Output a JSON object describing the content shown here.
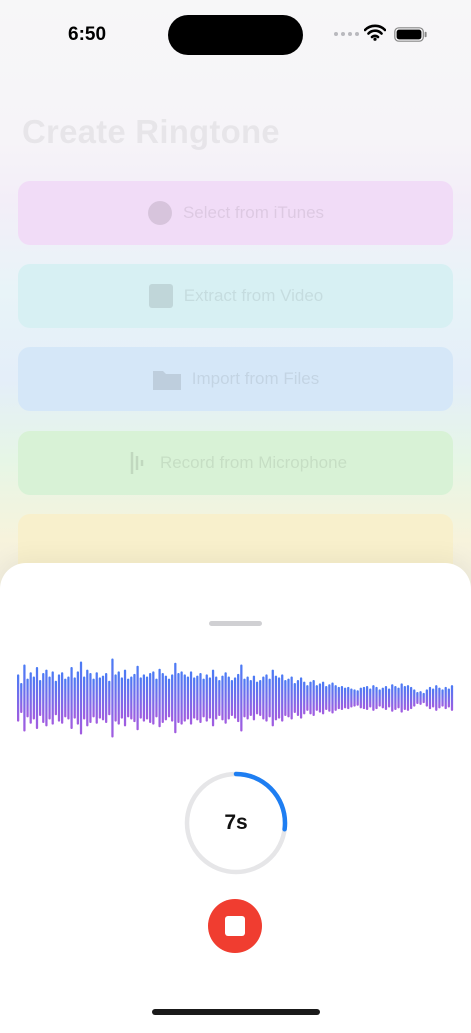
{
  "status_bar": {
    "time": "6:50"
  },
  "background_screen": {
    "title": "Create Ringtone",
    "options": [
      {
        "label": "Select from iTunes",
        "icon": "music-note-icon",
        "color": "#f1dcf7"
      },
      {
        "label": "Extract from Video",
        "icon": "video-icon",
        "color": "#d7f0f3"
      },
      {
        "label": "Import from Files",
        "icon": "folder-icon",
        "color": "#d5e7f8"
      },
      {
        "label": "Record from Microphone",
        "icon": "microphone-icon",
        "color": "#d8f2d6"
      },
      {
        "label": "",
        "icon": "",
        "color": "#f8f0cc"
      }
    ]
  },
  "recording_sheet": {
    "elapsed": "7s",
    "progress_fraction": 0.27,
    "colors": {
      "waveform_top": "#4a7bf5",
      "waveform_bottom": "#a25ce0",
      "progress": "#1e7ef2",
      "track": "#e6e6e8",
      "stop": "#f03d30"
    },
    "waveform_levels": [
      0.55,
      0.35,
      0.78,
      0.45,
      0.6,
      0.5,
      0.72,
      0.42,
      0.58,
      0.66,
      0.5,
      0.62,
      0.4,
      0.55,
      0.6,
      0.45,
      0.5,
      0.72,
      0.48,
      0.62,
      0.85,
      0.5,
      0.66,
      0.58,
      0.45,
      0.6,
      0.48,
      0.52,
      0.58,
      0.4,
      0.92,
      0.55,
      0.62,
      0.48,
      0.66,
      0.45,
      0.5,
      0.56,
      0.75,
      0.48,
      0.55,
      0.5,
      0.58,
      0.62,
      0.45,
      0.68,
      0.58,
      0.52,
      0.45,
      0.55,
      0.82,
      0.58,
      0.62,
      0.55,
      0.5,
      0.62,
      0.48,
      0.52,
      0.58,
      0.45,
      0.55,
      0.48,
      0.66,
      0.5,
      0.42,
      0.52,
      0.6,
      0.5,
      0.42,
      0.48,
      0.56,
      0.78,
      0.45,
      0.5,
      0.42,
      0.52,
      0.38,
      0.42,
      0.5,
      0.55,
      0.45,
      0.66,
      0.52,
      0.48,
      0.55,
      0.42,
      0.45,
      0.5,
      0.35,
      0.42,
      0.48,
      0.38,
      0.3,
      0.38,
      0.42,
      0.3,
      0.34,
      0.38,
      0.28,
      0.32,
      0.36,
      0.3,
      0.26,
      0.28,
      0.24,
      0.26,
      0.22,
      0.2,
      0.18,
      0.24,
      0.26,
      0.28,
      0.22,
      0.3,
      0.26,
      0.2,
      0.24,
      0.28,
      0.22,
      0.32,
      0.28,
      0.24,
      0.34,
      0.28,
      0.3,
      0.26,
      0.2,
      0.14,
      0.16,
      0.12,
      0.2,
      0.26,
      0.22,
      0.3,
      0.24,
      0.2,
      0.26,
      0.22,
      0.3
    ]
  }
}
